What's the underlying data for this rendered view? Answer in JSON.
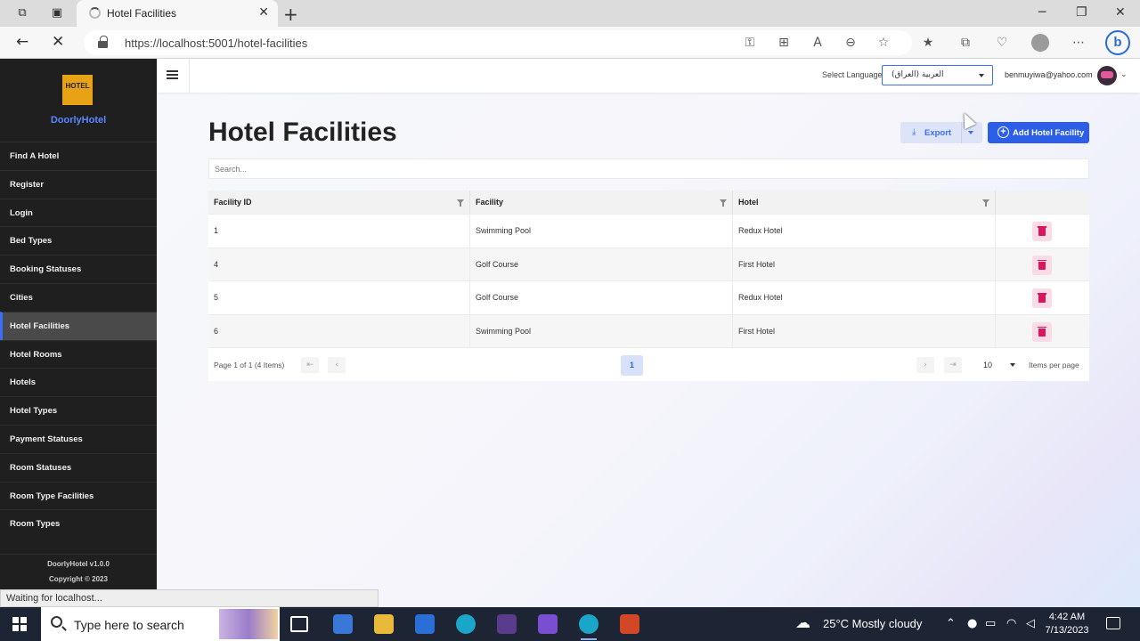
{
  "browser": {
    "tab_title": "Hotel Facilities",
    "url": "https://localhost:5001/hotel-facilities",
    "status_text": "Waiting for localhost..."
  },
  "sidebar": {
    "logo_text": "HOTEL",
    "brand": "DoorlyHotel",
    "items": [
      {
        "label": "Find A Hotel"
      },
      {
        "label": "Register"
      },
      {
        "label": "Login"
      },
      {
        "label": "Bed Types"
      },
      {
        "label": "Booking Statuses"
      },
      {
        "label": "Cities"
      },
      {
        "label": "Hotel Facilities",
        "active": true
      },
      {
        "label": "Hotel Rooms"
      },
      {
        "label": "Hotels"
      },
      {
        "label": "Hotel Types"
      },
      {
        "label": "Payment Statuses"
      },
      {
        "label": "Room Statuses"
      },
      {
        "label": "Room Type Facilities"
      },
      {
        "label": "Room Types"
      }
    ],
    "version": "DoorlyHotel v1.0.0",
    "copyright": "Copyright © 2023"
  },
  "topbar": {
    "language_label": "Select Language",
    "language_value": "العربية (العراق)",
    "user_email": "benmuyiwa@yahoo.com"
  },
  "page": {
    "title": "Hotel Facilities",
    "export_label": "Export",
    "add_label": "Add Hotel Facility",
    "search_placeholder": "Search..."
  },
  "grid": {
    "columns": [
      "Facility ID",
      "Facility",
      "Hotel"
    ],
    "rows": [
      {
        "id": "1",
        "facility": "Swimming Pool",
        "hotel": "Redux Hotel"
      },
      {
        "id": "4",
        "facility": "Golf Course",
        "hotel": "First Hotel"
      },
      {
        "id": "5",
        "facility": "Golf Course",
        "hotel": "Redux Hotel"
      },
      {
        "id": "6",
        "facility": "Swimming Pool",
        "hotel": "First Hotel"
      }
    ],
    "pager": {
      "info": "Page 1 of 1 (4 Items)",
      "current_page": "1",
      "page_size": "10",
      "items_per_page": "Items per page"
    }
  },
  "taskbar": {
    "search_placeholder": "Type here to search",
    "weather": "25°C  Mostly cloudy",
    "time": "4:42 AM",
    "date": "7/13/2023"
  }
}
